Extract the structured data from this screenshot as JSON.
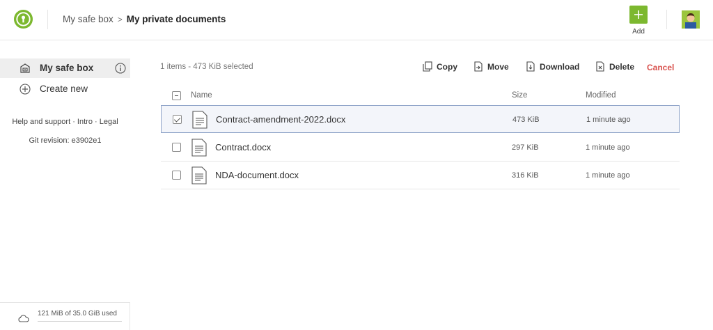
{
  "colors": {
    "brand_green": "#7cb82f",
    "danger": "#d9534f",
    "selection_border": "#8ea3c8"
  },
  "header": {
    "breadcrumb_root": "My safe box",
    "breadcrumb_separator": ">",
    "breadcrumb_current": "My private documents",
    "add_label": "Add"
  },
  "sidebar": {
    "items": [
      {
        "label": "My safe box",
        "icon": "safe-box-icon",
        "active": true
      },
      {
        "label": "Create new",
        "icon": "plus-circle-icon",
        "active": false
      }
    ],
    "links": {
      "help": "Help and support",
      "intro": "Intro",
      "legal": "Legal",
      "dot": " · "
    },
    "git_revision": "Git revision: e3902e1",
    "quota": "121 MiB of 35.0 GiB used"
  },
  "toolbar": {
    "selection_info": "1 items - 473 KiB selected",
    "copy": "Copy",
    "move": "Move",
    "download": "Download",
    "delete": "Delete",
    "cancel": "Cancel"
  },
  "table": {
    "columns": {
      "name": "Name",
      "size": "Size",
      "modified": "Modified"
    },
    "rows": [
      {
        "name": "Contract-amendment-2022.docx",
        "size": "473 KiB",
        "modified": "1 minute ago",
        "selected": true
      },
      {
        "name": "Contract.docx",
        "size": "297 KiB",
        "modified": "1 minute ago",
        "selected": false
      },
      {
        "name": "NDA-document.docx",
        "size": "316 KiB",
        "modified": "1 minute ago",
        "selected": false
      }
    ]
  }
}
